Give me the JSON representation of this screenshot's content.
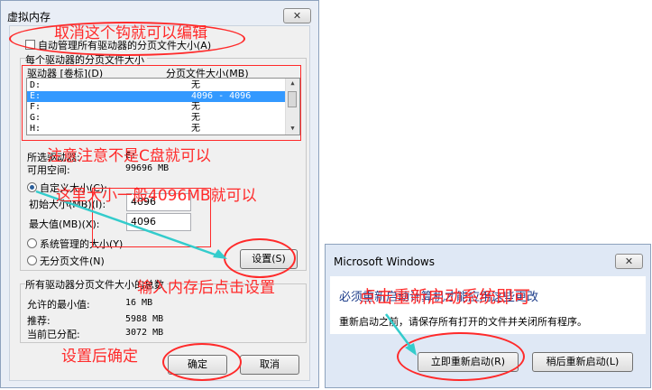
{
  "left_dialog": {
    "title": "虚拟内存",
    "close_label": "✕",
    "auto_manage_label": "自动管理所有驱动器的分页文件大小(A)",
    "group_label": "每个驱动器的分页文件大小",
    "col_drive": "驱动器 [卷标](D)",
    "col_size": "分页文件大小(MB)",
    "drives": [
      {
        "drive": "D:",
        "size": "无"
      },
      {
        "drive": "E:",
        "size": "4096 - 4096"
      },
      {
        "drive": "F:",
        "size": "无"
      },
      {
        "drive": "G:",
        "size": "无"
      },
      {
        "drive": "H:",
        "size": "无"
      }
    ],
    "selected_drive_label": "所选驱动器:",
    "selected_drive_value": "E:",
    "free_space_label": "可用空间:",
    "free_space_value": "99696 MB",
    "custom_size_label": "自定义大小(C):",
    "initial_size_label": "初始大小(MB)(I):",
    "initial_size_value": "4096",
    "max_size_label": "最大值(MB)(X):",
    "max_size_value": "4096",
    "system_managed_label": "系统管理的大小(Y)",
    "no_paging_label": "无分页文件(N)",
    "set_button": "设置(S)",
    "total_group_label": "所有驱动器分页文件大小的总数",
    "min_allowed_label": "允许的最小值:",
    "min_allowed_value": "16 MB",
    "recommended_label": "推荐:",
    "recommended_value": "5988 MB",
    "allocated_label": "当前已分配:",
    "allocated_value": "3072 MB",
    "ok_button": "确定",
    "cancel_button": "取消"
  },
  "right_dialog": {
    "title": "Microsoft Windows",
    "close_label": "✕",
    "message_main": "必须重新启动计算机才能应用这些更改",
    "message_sub": "重新启动之前，请保存所有打开的文件并关闭所有程序。",
    "restart_now_button": "立即重新启动(R)",
    "restart_later_button": "稍后重新启动(L)"
  },
  "annotations": {
    "uncheck_note": "取消这个钩就可以编辑",
    "not_c_note": "注意注意不是C盘就可以",
    "size_note": "这里大小一般4096MB就可以",
    "after_input_note": "输入内存后点击设置",
    "confirm_note": "设置后确定",
    "restart_note": "点击重新启动系统即可"
  },
  "colors": {
    "annotation": "#ff2a2a",
    "arrow": "#33cccc",
    "selection": "#3399ff"
  }
}
